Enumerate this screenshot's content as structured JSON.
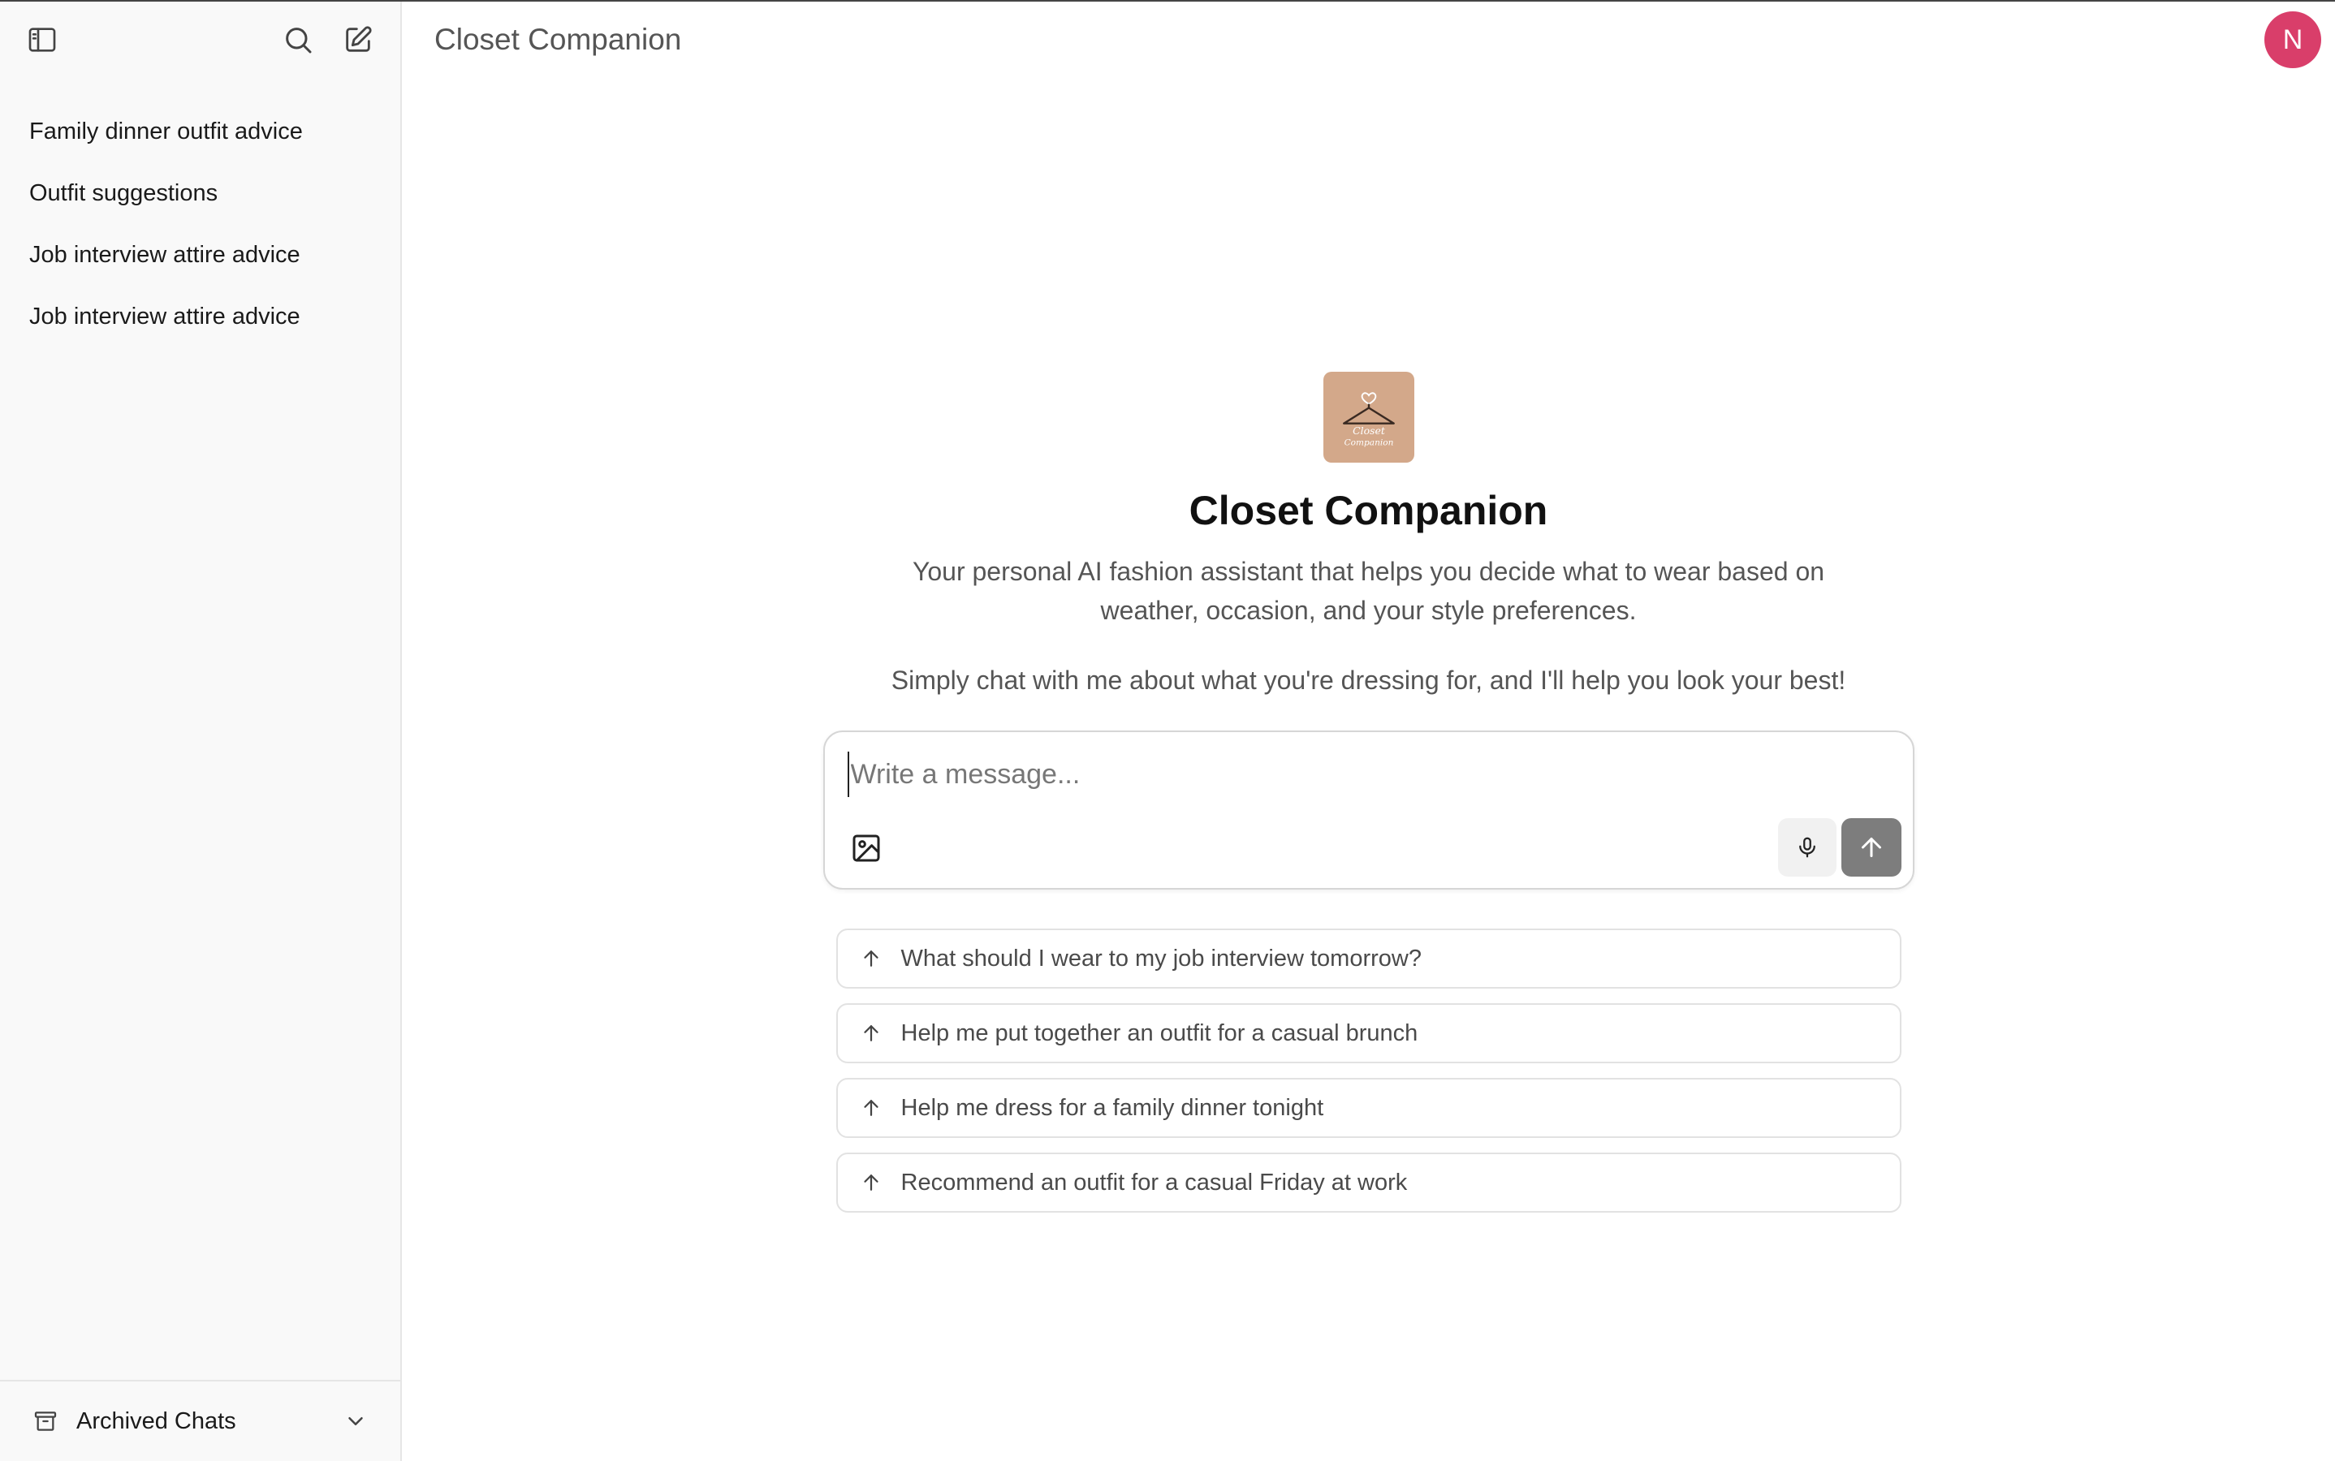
{
  "app": {
    "title": "Closet Companion"
  },
  "sidebar": {
    "chats": [
      {
        "label": "Family dinner outfit advice"
      },
      {
        "label": "Outfit suggestions"
      },
      {
        "label": "Job interview attire advice"
      },
      {
        "label": "Job interview attire advice"
      }
    ],
    "archived_label": "Archived Chats"
  },
  "user": {
    "avatar_initial": "N",
    "avatar_color": "#d93e6a"
  },
  "assistant": {
    "logo_text_line1": "Closet",
    "logo_text_line2": "Companion",
    "name": "Closet Companion",
    "description": "Your personal AI fashion assistant that helps you decide what to wear based on weather, occasion, and your style preferences.",
    "description2": "Simply chat with me about what you're dressing for, and I'll help you look your best!"
  },
  "composer": {
    "placeholder": "Write a message..."
  },
  "suggestions": [
    {
      "label": "What should I wear to my job interview tomorrow?"
    },
    {
      "label": "Help me put together an outfit for a casual brunch"
    },
    {
      "label": "Help me dress for a family dinner tonight"
    },
    {
      "label": "Recommend an outfit for a casual Friday at work"
    }
  ],
  "icons": {
    "sidebar_toggle": "sidebar-toggle-icon",
    "search": "search-icon",
    "new_chat": "new-chat-icon",
    "archive": "archive-icon",
    "chevron": "chevron-down-icon",
    "image": "image-icon",
    "mic": "microphone-icon",
    "send": "arrow-up-icon"
  },
  "colors": {
    "logo_bg": "#d3a88a",
    "send_bg": "#7d7d7d"
  }
}
